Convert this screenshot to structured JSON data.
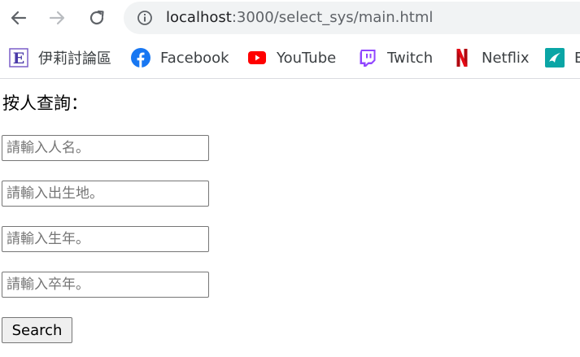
{
  "browser": {
    "url_host": "localhost",
    "url_rest": ":3000/select_sys/main.html"
  },
  "bookmarks": [
    {
      "label": "伊莉討論區",
      "icon": "eyny-icon"
    },
    {
      "label": "Facebook",
      "icon": "facebook-icon",
      "color": "#1877f2"
    },
    {
      "label": "YouTube",
      "icon": "youtube-icon",
      "color": "#ff0000"
    },
    {
      "label": "Twitch",
      "icon": "twitch-icon",
      "color": "#9146ff"
    },
    {
      "label": "Netflix",
      "icon": "netflix-icon",
      "color": "#e50914"
    },
    {
      "label": "E",
      "icon": "teal-bookmark-icon",
      "color": "#0aa5a5"
    }
  ],
  "form": {
    "title": "按人查詢：",
    "name_placeholder": "請輸入人名。",
    "birthplace_placeholder": "請輸入出生地。",
    "birth_year_placeholder": "請輸入生年。",
    "death_year_placeholder": "請輸入卒年。",
    "search_label": "Search"
  }
}
